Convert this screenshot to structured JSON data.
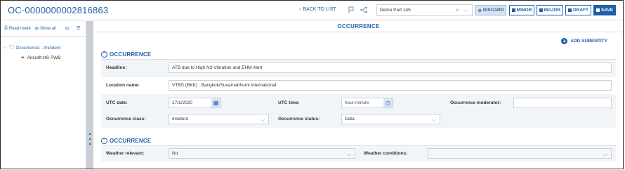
{
  "header": {
    "title": "OC-0000000002816863",
    "back_label": "BACK TO LIST",
    "demo_select_value": "Demo Part 145",
    "buttons": {
      "discard": "DISCARD",
      "minor": "MINOR",
      "major": "MAJOR",
      "draft": "DRAFT",
      "save": "SAVE"
    }
  },
  "left_panel": {
    "toolbar": {
      "read_mode": "Read mode",
      "show_all": "Show all"
    },
    "tree": {
      "root_label": "Occurrence: -/Incident",
      "child_label": "Aircraft:HS-TWB"
    }
  },
  "main": {
    "title": "OCCURRENCE",
    "add_subentity": "ADD SUBENTITY",
    "section1": {
      "title": "OCCURRENCE",
      "headline_label": "Headline:",
      "headline_value": "ATB due to High N3 Vibration and EHM Alert",
      "location_label": "Location name:",
      "location_value": "VTBS (BKK) : Bangkok/Suvarnabhumi International",
      "utc_date_label": "UTC date:",
      "utc_date_value": "17/1/2020",
      "utc_time_label": "UTC time:",
      "utc_time_placeholder": "hour:minute",
      "moderator_label": "Occurrence moderator:",
      "moderator_value": "",
      "class_label": "Occurrence class:",
      "class_value": "Incident",
      "status_label": "Occurrence status:",
      "status_value": "Data"
    },
    "section2": {
      "title": "OCCURRENCE",
      "weather_relevant_label": "Weather relevant:",
      "weather_relevant_value": "No",
      "weather_conditions_label": "Weather conditions:",
      "weather_conditions_value": ""
    }
  },
  "colors": {
    "accent": "#1f5fa8",
    "splitter": "#c9ced4",
    "band": "#f2f5f8"
  }
}
